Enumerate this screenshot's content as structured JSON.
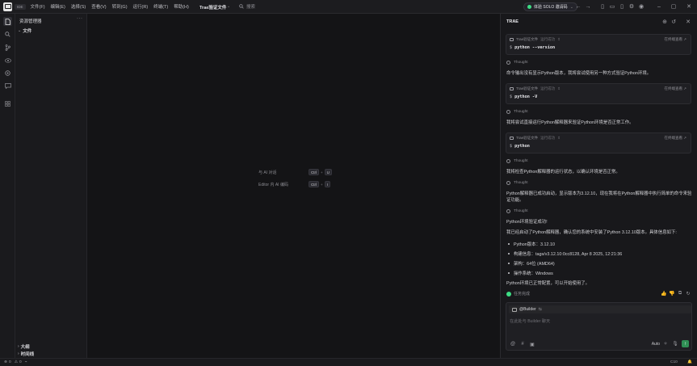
{
  "titlebar": {
    "ide_badge": "IDE",
    "menus": [
      "文件(F)",
      "编辑(E)",
      "选择(S)",
      "查看(V)",
      "转到(G)",
      "运行(R)",
      "终端(T)",
      "帮助(H)"
    ],
    "project_title": "Trae验证文件",
    "search_placeholder": "搜索",
    "solo_label": "体验 SOLO 邀请码"
  },
  "sidebar": {
    "title": "资源管理器",
    "folder": "文件",
    "bottom_sections": [
      "大纲",
      "时间线"
    ]
  },
  "editor": {
    "hints": [
      {
        "label": "与 AI 对话",
        "keys": [
          "Ctrl",
          "U"
        ]
      },
      {
        "label": "Editor 内 AI 编码",
        "keys": [
          "Ctrl",
          "I"
        ]
      }
    ]
  },
  "panel": {
    "title": "TRAE",
    "term_header": "Trae验证文件",
    "term_status": "运行成功",
    "term_open": "在终端查看",
    "commands": [
      "python --version",
      "python -V",
      "python"
    ],
    "thought_label": "Thought",
    "messages": [
      "命令输出没有显示Python版本，我将尝试使用另一种方式验证Python环境。",
      "我将尝试直接运行Python解释器来验证Python环境是否正常工作。",
      "我将检查Python解释器的运行状态，以确认环境是否正常。",
      "Python解释器已成功启动，显示版本为3.12.10，现在我将在Python解释器中执行简单的命令来验证功能。",
      "Python环境验证成功!",
      "我已经启动了Python解释器，确认您的系统中安装了Python 3.12.10版本。具体信息如下:"
    ],
    "bullets": [
      "Python版本：3.12.10",
      "构建信息：tags/v3.12.10:0cc8128, Apr 8 2025, 12:21:36",
      "架构：64位 (AMD64)",
      "操作系统：Windows"
    ],
    "closing": "Python环境已正常配置，可以开始使用了。",
    "task_done": "任务完成",
    "agent_name": "@Builder",
    "input_placeholder": "在此处与 Builder 聊天",
    "mode": "Auto"
  },
  "statusbar": {
    "errors": "0",
    "warnings": "0",
    "right": "C10"
  }
}
